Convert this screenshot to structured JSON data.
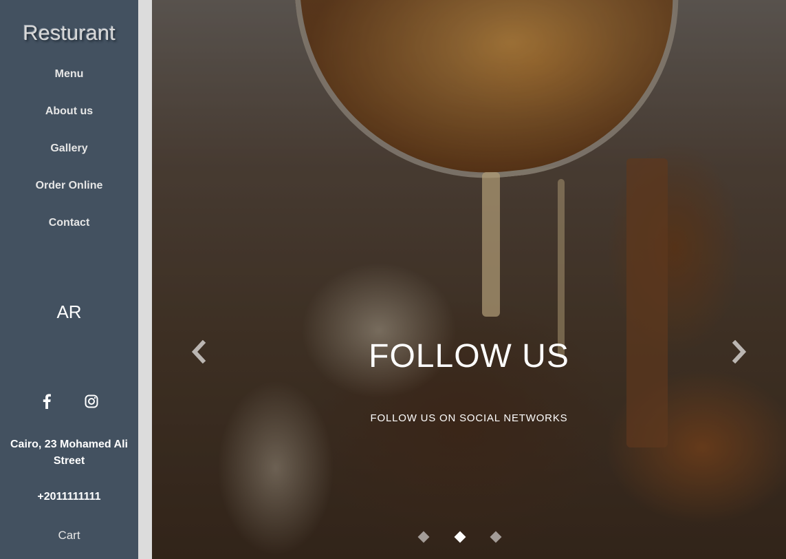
{
  "sidebar": {
    "brand": "Resturant",
    "nav": [
      "Menu",
      "About us",
      "Gallery",
      "Order Online",
      "Contact"
    ],
    "language": "AR",
    "social": [
      {
        "icon": "facebook-icon"
      },
      {
        "icon": "instagram-icon"
      }
    ],
    "address": "Cairo, 23 Mohamed Ali Street",
    "phone": "+2011111111",
    "cart": "Cart"
  },
  "hero": {
    "title": "FOLLOW US",
    "subtitle": "FOLLOW US ON SOCIAL NETWORKS",
    "slides_total": 3,
    "active_slide": 2
  },
  "colors": {
    "sidebar_bg": "#435160",
    "sidebar_text": "#e6e6e6"
  }
}
